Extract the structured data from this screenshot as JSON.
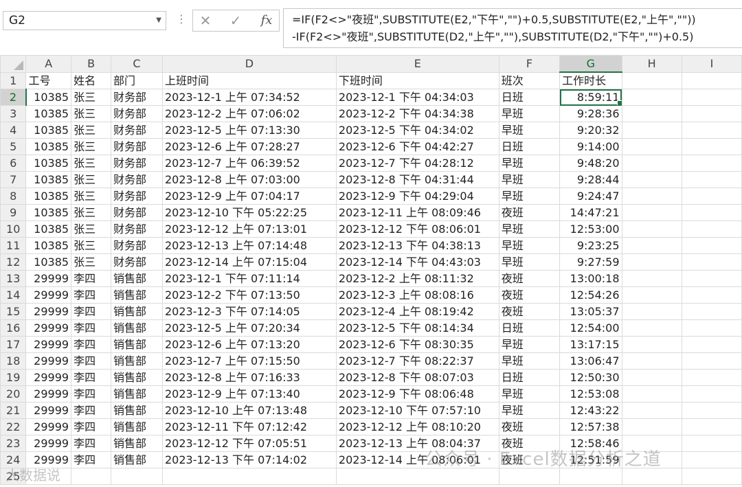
{
  "formula_bar": {
    "name_box": "G2",
    "cancel_icon": "✕",
    "enter_icon": "✓",
    "fx_label": "fx",
    "formula": "=IF(F2<>\"夜班\",SUBSTITUTE(E2,\"下午\",\"\")+0.5,SUBSTITUTE(E2,\"上午\",\"\"))\n-IF(F2<>\"夜班\",SUBSTITUTE(D2,\"上午\",\"\"),SUBSTITUTE(D2,\"下午\",\"\")+0.5)"
  },
  "columns": [
    "A",
    "B",
    "C",
    "D",
    "E",
    "F",
    "G",
    "H",
    "I"
  ],
  "active_cell": {
    "row": 2,
    "col": "G"
  },
  "rows": [
    [
      "工号",
      "姓名",
      "部门",
      "上班时间",
      "下班时间",
      "班次",
      "工作时长"
    ],
    [
      "10385",
      "张三",
      "财务部",
      "2023-12-1 上午 07:34:52",
      "2023-12-1 下午 04:34:03",
      "日班",
      "8:59:11"
    ],
    [
      "10385",
      "张三",
      "财务部",
      "2023-12-2 上午 07:06:02",
      "2023-12-2 下午 04:34:38",
      "早班",
      "9:28:36"
    ],
    [
      "10385",
      "张三",
      "财务部",
      "2023-12-5 上午 07:13:30",
      "2023-12-5 下午 04:34:02",
      "早班",
      "9:20:32"
    ],
    [
      "10385",
      "张三",
      "财务部",
      "2023-12-6 上午 07:28:27",
      "2023-12-6 下午 04:42:27",
      "日班",
      "9:14:00"
    ],
    [
      "10385",
      "张三",
      "财务部",
      "2023-12-7 上午 06:39:52",
      "2023-12-7 下午 04:28:12",
      "早班",
      "9:48:20"
    ],
    [
      "10385",
      "张三",
      "财务部",
      "2023-12-8 上午 07:03:00",
      "2023-12-8 下午 04:31:44",
      "早班",
      "9:28:44"
    ],
    [
      "10385",
      "张三",
      "财务部",
      "2023-12-9 上午 07:04:17",
      "2023-12-9 下午 04:29:04",
      "早班",
      "9:24:47"
    ],
    [
      "10385",
      "张三",
      "财务部",
      "2023-12-10 下午 05:22:25",
      "2023-12-11 上午 08:09:46",
      "夜班",
      "14:47:21"
    ],
    [
      "10385",
      "张三",
      "财务部",
      "2023-12-12 上午 07:13:01",
      "2023-12-12 下午 08:06:01",
      "早班",
      "12:53:00"
    ],
    [
      "10385",
      "张三",
      "财务部",
      "2023-12-13 上午 07:14:48",
      "2023-12-13 下午 04:38:13",
      "早班",
      "9:23:25"
    ],
    [
      "10385",
      "张三",
      "财务部",
      "2023-12-14 上午 07:15:04",
      "2023-12-14 下午 04:43:03",
      "早班",
      "9:27:59"
    ],
    [
      "29999",
      "李四",
      "销售部",
      "2023-12-1 下午 07:11:14",
      "2023-12-2 上午 08:11:32",
      "夜班",
      "13:00:18"
    ],
    [
      "29999",
      "李四",
      "销售部",
      "2023-12-2 下午 07:13:50",
      "2023-12-3 上午 08:08:16",
      "夜班",
      "12:54:26"
    ],
    [
      "29999",
      "李四",
      "销售部",
      "2023-12-3 下午 07:14:05",
      "2023-12-4 上午 08:19:42",
      "夜班",
      "13:05:37"
    ],
    [
      "29999",
      "李四",
      "销售部",
      "2023-12-5 上午 07:20:34",
      "2023-12-5 下午 08:14:34",
      "日班",
      "12:54:00"
    ],
    [
      "29999",
      "李四",
      "销售部",
      "2023-12-6 上午 07:13:20",
      "2023-12-6 下午 08:30:35",
      "早班",
      "13:17:15"
    ],
    [
      "29999",
      "李四",
      "销售部",
      "2023-12-7 上午 07:15:50",
      "2023-12-7 下午 08:22:37",
      "早班",
      "13:06:47"
    ],
    [
      "29999",
      "李四",
      "销售部",
      "2023-12-8 上午 07:16:33",
      "2023-12-8 下午 08:07:03",
      "日班",
      "12:50:30"
    ],
    [
      "29999",
      "李四",
      "销售部",
      "2023-12-9 上午 07:13:40",
      "2023-12-9 下午 08:06:48",
      "早班",
      "12:53:08"
    ],
    [
      "29999",
      "李四",
      "销售部",
      "2023-12-10 上午 07:13:48",
      "2023-12-10 下午 07:57:10",
      "早班",
      "12:43:22"
    ],
    [
      "29999",
      "李四",
      "销售部",
      "2023-12-11 下午 07:12:42",
      "2023-12-12 上午 08:10:20",
      "夜班",
      "12:57:38"
    ],
    [
      "29999",
      "李四",
      "销售部",
      "2023-12-12 下午 07:05:51",
      "2023-12-13 上午 08:04:37",
      "夜班",
      "12:58:46"
    ],
    [
      "29999",
      "李四",
      "销售部",
      "2023-12-13 下午 07:14:02",
      "2023-12-14 上午 08:06:01",
      "夜班",
      "12:51:59"
    ],
    [
      "",
      "",
      "",
      "",
      "",
      "",
      ""
    ]
  ],
  "watermark": "公众号 · Excel数据分析之道",
  "watermark_corner": "大数据说"
}
